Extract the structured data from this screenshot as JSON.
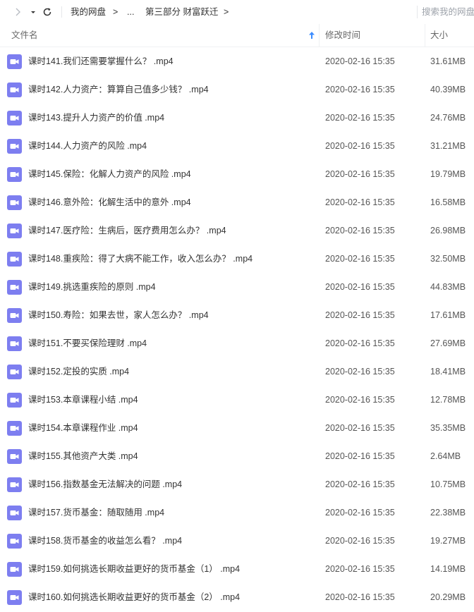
{
  "nav": {
    "breadcrumb_root": "我的网盘",
    "breadcrumb_ellipsis": "...",
    "breadcrumb_current": "第三部分 财富跃迁",
    "separator": ">",
    "search_placeholder": "搜索我的网盘"
  },
  "columns": {
    "name": "文件名",
    "modified": "修改时间",
    "size": "大小",
    "sort": "name ascending"
  },
  "colors": {
    "file_icon": "#7d7ef0",
    "sort_arrow": "#3b8cff"
  },
  "files": [
    {
      "name": "课时141.我们还需要掌握什么？ .mp4",
      "modified": "2020-02-16 15:35",
      "size": "31.61MB",
      "icon": "video-file-icon"
    },
    {
      "name": "课时142.人力资产：算算自己值多少钱？ .mp4",
      "modified": "2020-02-16 15:35",
      "size": "40.39MB",
      "icon": "video-file-icon"
    },
    {
      "name": "课时143.提升人力资产的价值 .mp4",
      "modified": "2020-02-16 15:35",
      "size": "24.76MB",
      "icon": "video-file-icon"
    },
    {
      "name": "课时144.人力资产的风险 .mp4",
      "modified": "2020-02-16 15:35",
      "size": "31.21MB",
      "icon": "video-file-icon"
    },
    {
      "name": "课时145.保险：化解人力资产的风险 .mp4",
      "modified": "2020-02-16 15:35",
      "size": "19.79MB",
      "icon": "video-file-icon"
    },
    {
      "name": "课时146.意外险：化解生活中的意外 .mp4",
      "modified": "2020-02-16 15:35",
      "size": "16.58MB",
      "icon": "video-file-icon"
    },
    {
      "name": "课时147.医疗险：生病后，医疗费用怎么办？ .mp4",
      "modified": "2020-02-16 15:35",
      "size": "26.98MB",
      "icon": "video-file-icon"
    },
    {
      "name": "课时148.重疾险：得了大病不能工作，收入怎么办？ .mp4",
      "modified": "2020-02-16 15:35",
      "size": "32.50MB",
      "icon": "video-file-icon"
    },
    {
      "name": "课时149.挑选重疾险的原则 .mp4",
      "modified": "2020-02-16 15:35",
      "size": "44.83MB",
      "icon": "video-file-icon"
    },
    {
      "name": "课时150.寿险：如果去世，家人怎么办？ .mp4",
      "modified": "2020-02-16 15:35",
      "size": "17.61MB",
      "icon": "video-file-icon"
    },
    {
      "name": "课时151.不要买保险理财 .mp4",
      "modified": "2020-02-16 15:35",
      "size": "27.69MB",
      "icon": "video-file-icon"
    },
    {
      "name": "课时152.定投的实质 .mp4",
      "modified": "2020-02-16 15:35",
      "size": "18.41MB",
      "icon": "video-file-icon"
    },
    {
      "name": "课时153.本章课程小结 .mp4",
      "modified": "2020-02-16 15:35",
      "size": "12.78MB",
      "icon": "video-file-icon"
    },
    {
      "name": "课时154.本章课程作业 .mp4",
      "modified": "2020-02-16 15:35",
      "size": "35.35MB",
      "icon": "video-file-icon"
    },
    {
      "name": "课时155.其他资产大类 .mp4",
      "modified": "2020-02-16 15:35",
      "size": "2.64MB",
      "icon": "video-file-icon"
    },
    {
      "name": "课时156.指数基金无法解决的问题 .mp4",
      "modified": "2020-02-16 15:35",
      "size": "10.75MB",
      "icon": "video-file-icon"
    },
    {
      "name": "课时157.货币基金：随取随用 .mp4",
      "modified": "2020-02-16 15:35",
      "size": "22.38MB",
      "icon": "video-file-icon"
    },
    {
      "name": "课时158.货币基金的收益怎么看？ .mp4",
      "modified": "2020-02-16 15:35",
      "size": "19.27MB",
      "icon": "video-file-icon"
    },
    {
      "name": "课时159.如何挑选长期收益更好的货币基金（1） .mp4",
      "modified": "2020-02-16 15:35",
      "size": "14.19MB",
      "icon": "video-file-icon"
    },
    {
      "name": "课时160.如何挑选长期收益更好的货币基金（2） .mp4",
      "modified": "2020-02-16 15:35",
      "size": "20.29MB",
      "icon": "video-file-icon"
    }
  ]
}
